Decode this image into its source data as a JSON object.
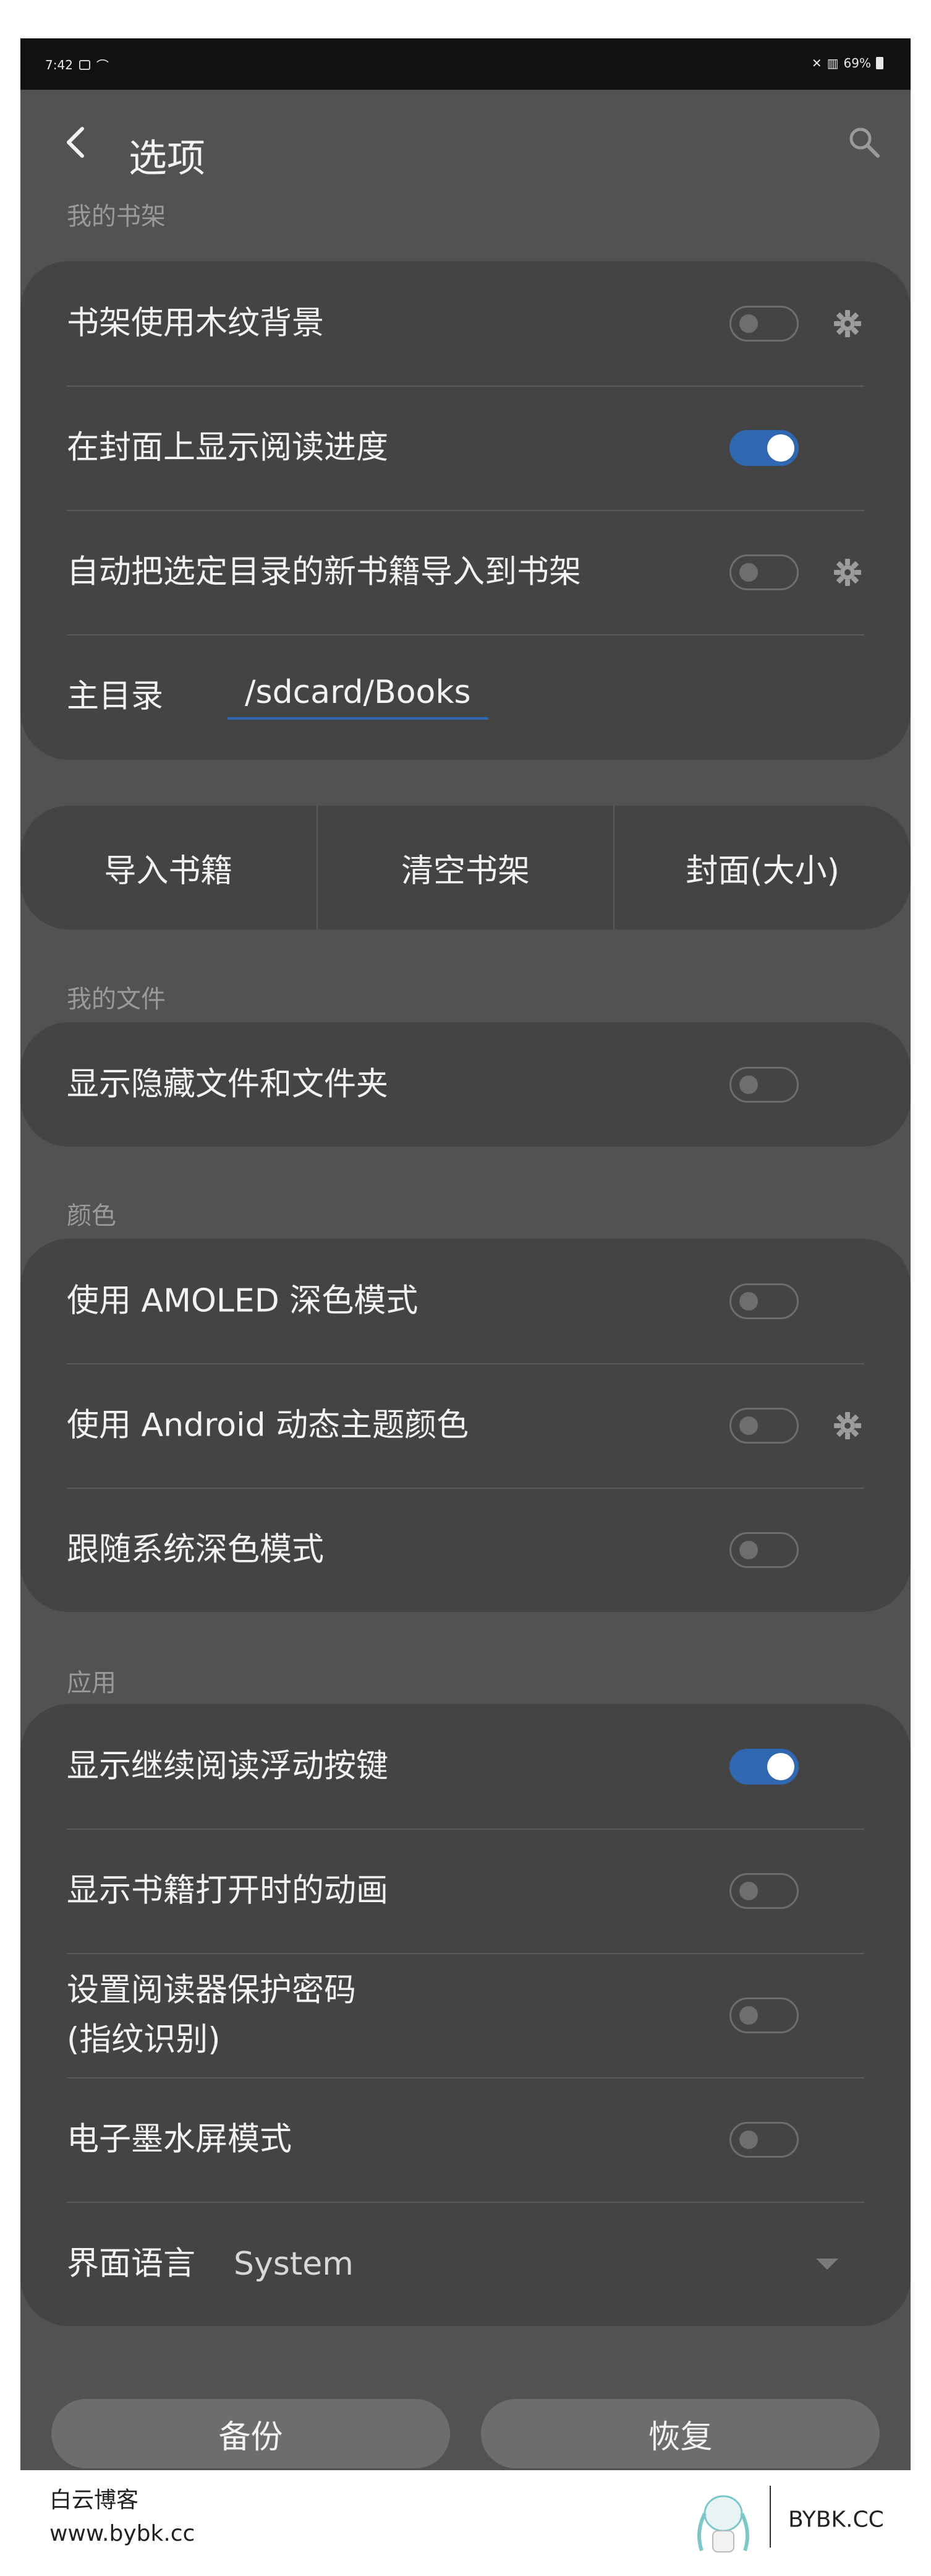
{
  "status_bar": {
    "time": "7:42",
    "battery": "69%"
  },
  "toolbar": {
    "title": "选项"
  },
  "sections": {
    "bookshelf": "我的书架",
    "files": "我的文件",
    "colors": "颜色",
    "app": "应用"
  },
  "bookshelf": {
    "wood_bg": "书架使用木纹背景",
    "show_progress": "在封面上显示阅读进度",
    "auto_import": "自动把选定目录的新书籍导入到书架",
    "home_dir_label": "主目录",
    "home_dir_value": "/sdcard/Books"
  },
  "bookshelf_buttons": {
    "import": "导入书籍",
    "clear": "清空书架",
    "cover": "封面(大小)"
  },
  "files": {
    "show_hidden": "显示隐藏文件和文件夹"
  },
  "colors": {
    "amoled": "使用 AMOLED 深色模式",
    "dynamic": "使用 Android 动态主题颜色",
    "follow_system": "跟随系统深色模式"
  },
  "app": {
    "continue_fab": "显示继续阅读浮动按键",
    "open_anim": "显示书籍打开时的动画",
    "password_line1": "设置阅读器保护密码",
    "password_line2": "(指纹识别)",
    "eink": "电子墨水屏模式",
    "language_label": "界面语言",
    "language_value": "System"
  },
  "toggles": {
    "wood_bg": false,
    "show_progress": true,
    "auto_import": false,
    "show_hidden": false,
    "amoled": false,
    "dynamic": false,
    "follow_system": false,
    "continue_fab": true,
    "open_anim": false,
    "password": false,
    "eink": false
  },
  "bottom_buttons": {
    "backup": "备份",
    "restore": "恢复"
  },
  "footer": {
    "site_name": "白云博客",
    "site_url": "www.bybk.cc",
    "logo_text": "BYBK.CC"
  },
  "colors_palette": {
    "background": "#525252",
    "card": "#444444",
    "accent": "#2f68b0"
  }
}
